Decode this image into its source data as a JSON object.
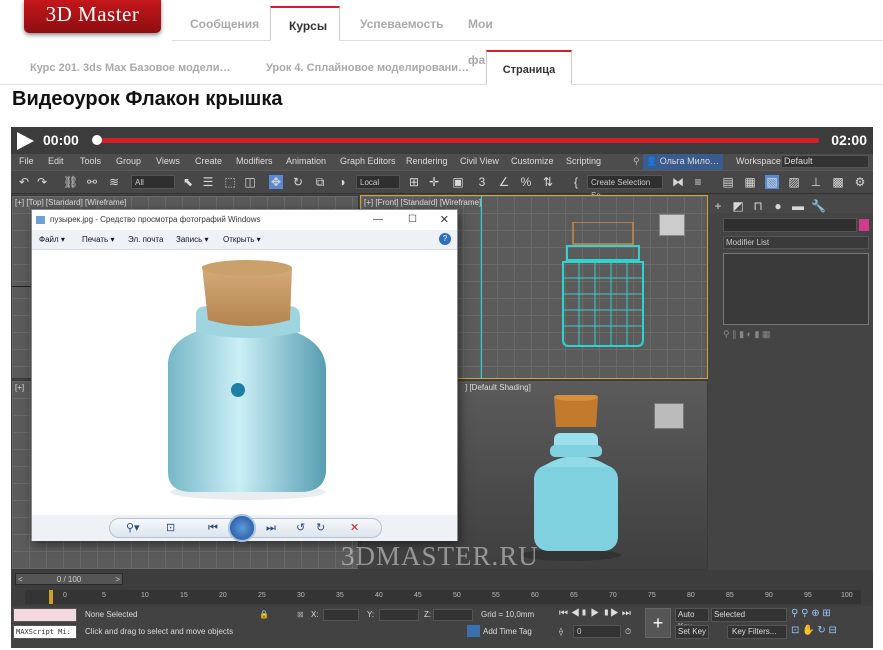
{
  "site": {
    "logo": "3D Master"
  },
  "nav": {
    "tabs": [
      {
        "label": "Сообщения"
      },
      {
        "label": "Курсы"
      },
      {
        "label": "Успеваемость"
      },
      {
        "label": "Мои файлы"
      }
    ]
  },
  "subnav": {
    "tabs": [
      {
        "label": "Курс 201. 3ds Max Базовое модели…"
      },
      {
        "label": "Урок 4. Сплайновое моделировани…"
      },
      {
        "label": "Страница"
      }
    ]
  },
  "page": {
    "title": "Видеоурок Флакон крышка"
  },
  "player": {
    "current_time": "00:00",
    "duration": "02:00",
    "progress": 0.0
  },
  "max": {
    "menu": [
      "File",
      "Edit",
      "Tools",
      "Group",
      "Views",
      "Create",
      "Modifiers",
      "Animation",
      "Graph Editors",
      "Rendering",
      "Civil View",
      "Customize",
      "Scripting"
    ],
    "user": "Ольга Мило…",
    "workspaces_label": "Workspaces:",
    "workspace": "Default",
    "filter": "All",
    "coord": "Local",
    "selection_set": "Create Selection Se",
    "viewports": {
      "top": "[+] [Top] [Standard] [Wireframe]",
      "front": "[+] [Front] [Standard] [Wireframe]",
      "left": "[+]",
      "persp": "] [Default Shading]"
    },
    "modifier_list": "Modifier List",
    "time_slider": "0 / 100",
    "ruler": [
      "0",
      "5",
      "10",
      "15",
      "20",
      "25",
      "30",
      "35",
      "40",
      "45",
      "50",
      "55",
      "60",
      "65",
      "70",
      "75",
      "80",
      "85",
      "90",
      "95",
      "100"
    ],
    "status": {
      "selection": "None Selected",
      "hint": "Click and drag to select and move objects",
      "x": "X:",
      "y": "Y:",
      "z": "Z:",
      "grid": "Grid = 10,0mm",
      "add_time_tag": "Add Time Tag",
      "auto_key": "Auto Key",
      "set_key": "Set Key",
      "selected": "Selected",
      "key_filters": "Key Filters...",
      "frame": "0",
      "maxscript": "MAXScript Mi:"
    }
  },
  "photo_viewer": {
    "title": "пузырек.jpg - Средство просмотра фотографий Windows",
    "menu": [
      "Файл",
      "Печать",
      "Эл. почта",
      "Запись",
      "Открыть"
    ]
  },
  "watermark": "3DMASTER.RU",
  "colors": {
    "accent": "#d32027",
    "bottle": "#7fd1e0",
    "cork": "#c47a2c"
  }
}
